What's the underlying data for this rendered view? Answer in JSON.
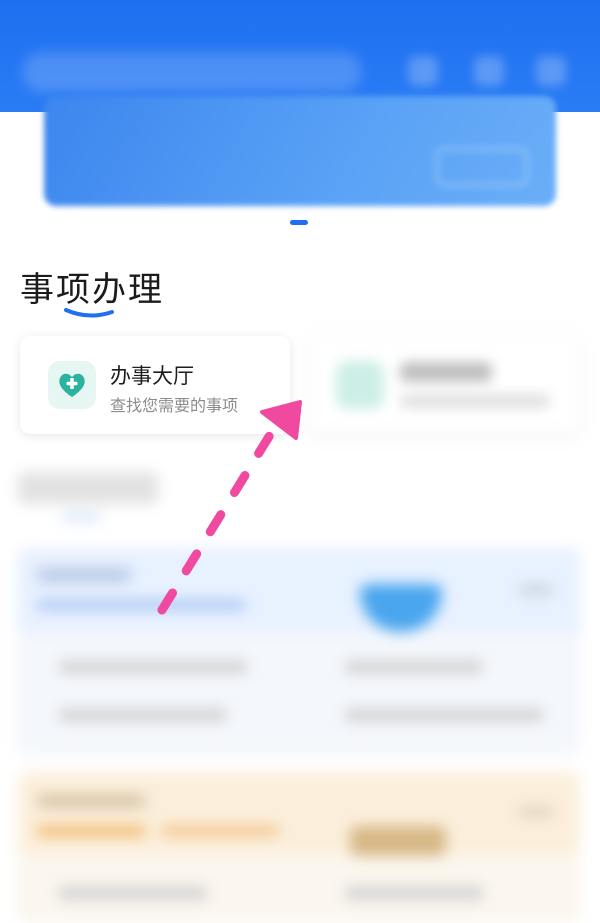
{
  "section": {
    "title": "事项办理"
  },
  "cards": [
    {
      "title": "办事大厅",
      "subtitle": "查找您需要的事项",
      "icon": "heart-plus-icon"
    }
  ],
  "colors": {
    "header_blue": "#1f6ff0",
    "icon_teal": "#2bb3a0",
    "annotation_pink": "#f04aa0"
  }
}
